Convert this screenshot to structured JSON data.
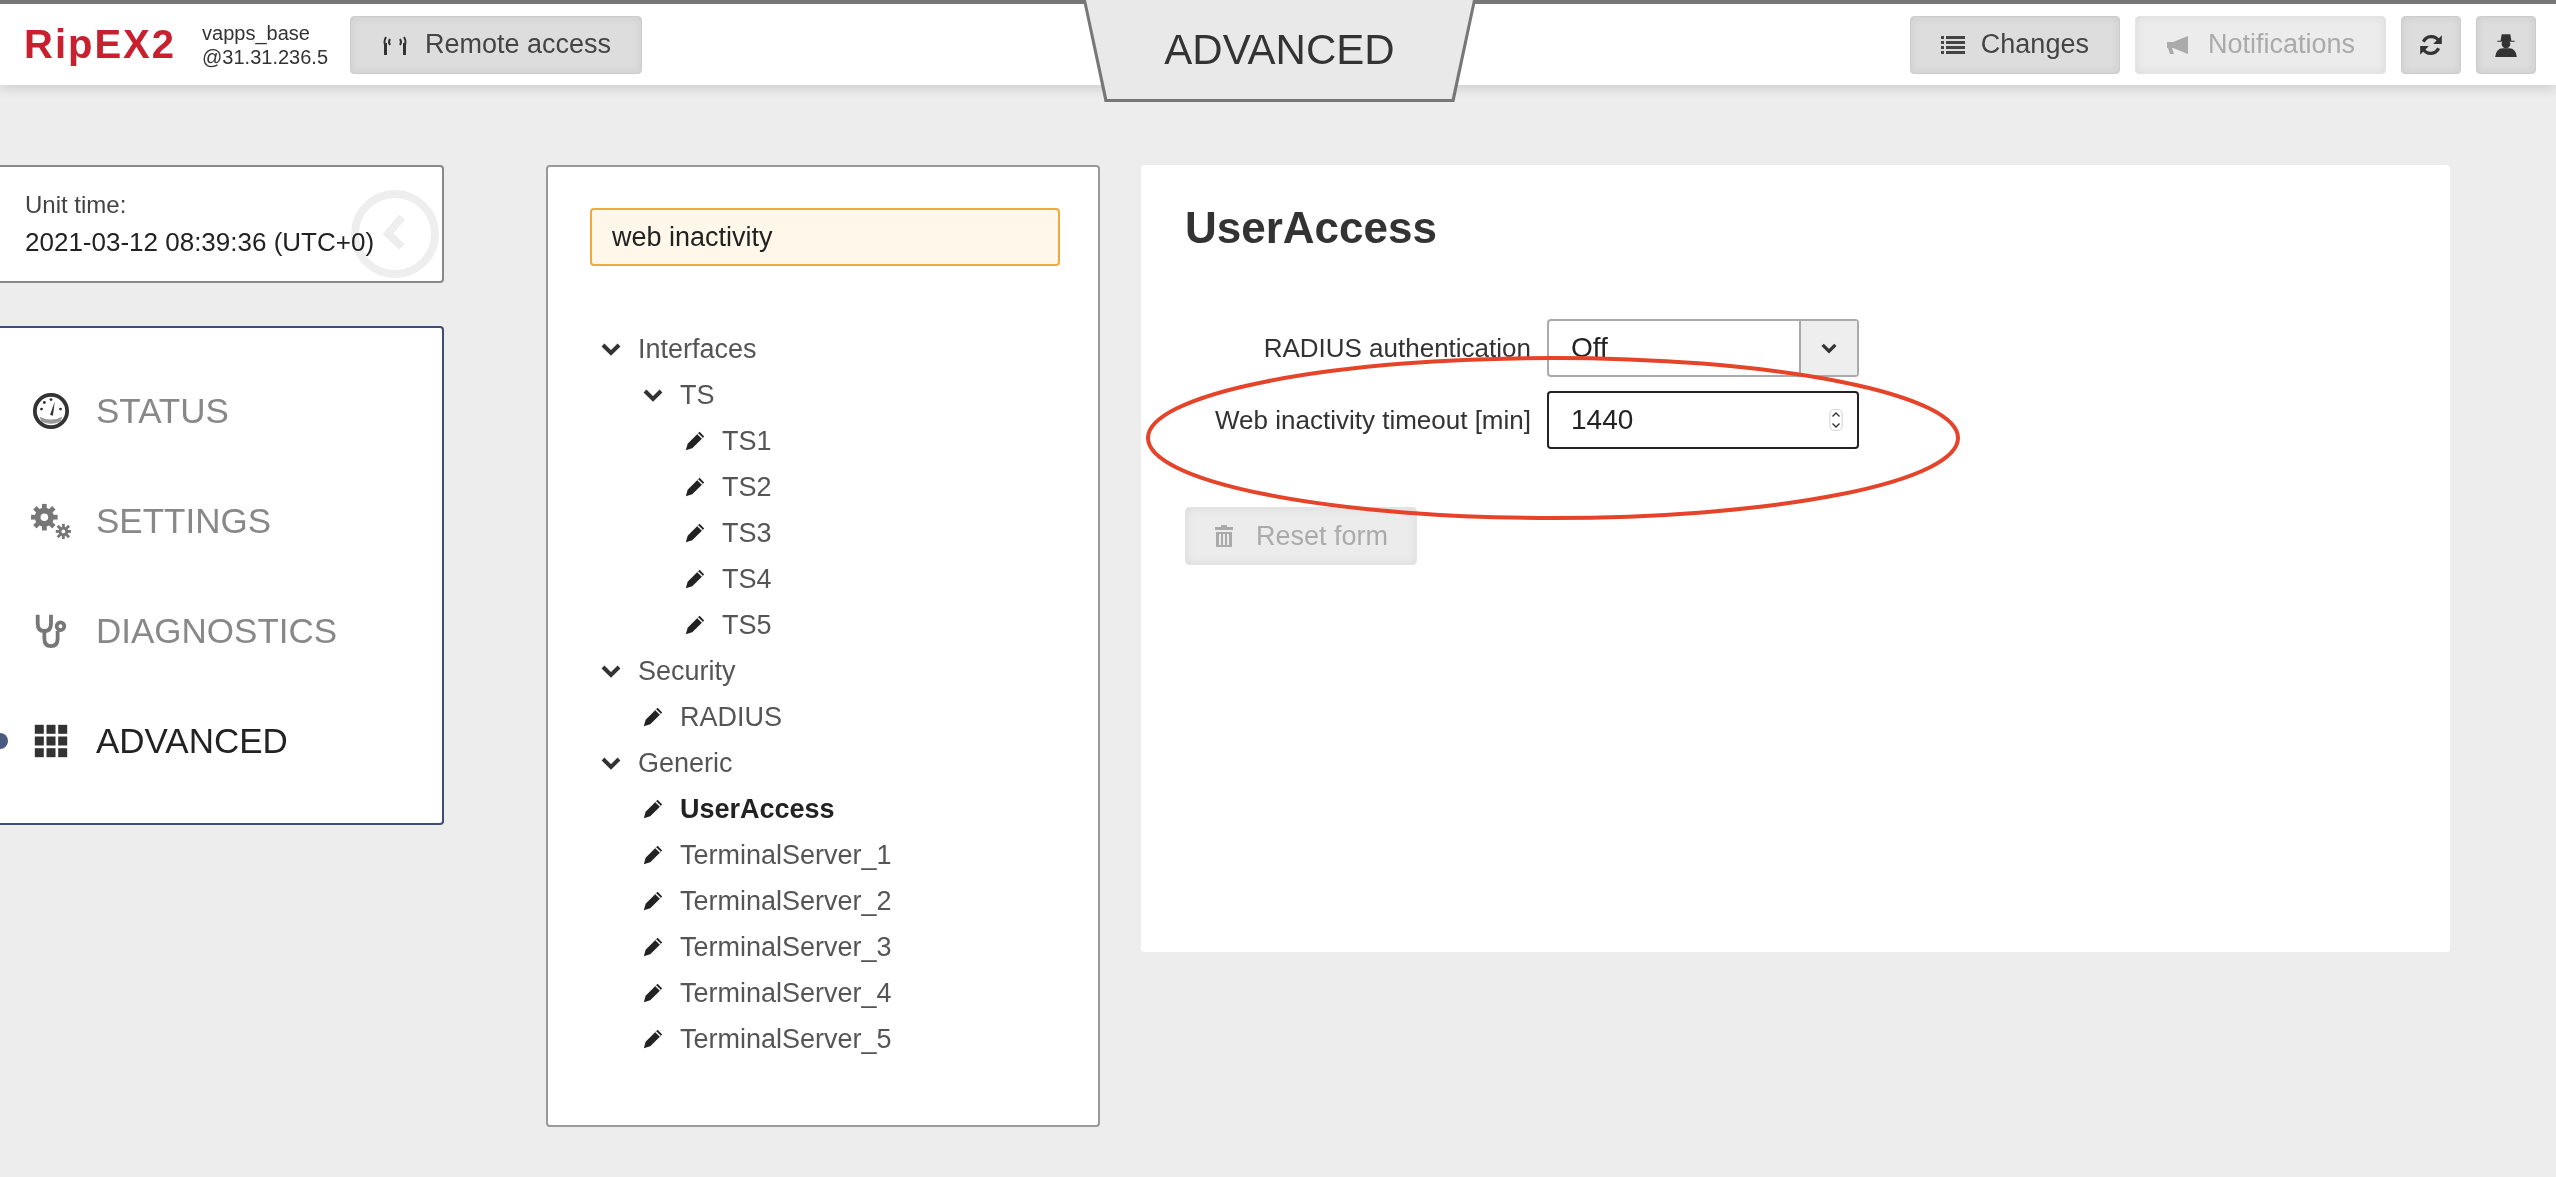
{
  "header": {
    "logo": "RipEX2",
    "unit_name": "vapps_base",
    "unit_address": "@31.31.236.5",
    "remote_button": "Remote access",
    "page_title": "ADVANCED",
    "actions": [
      {
        "kind": "changes",
        "label": "Changes",
        "disabled": false
      },
      {
        "kind": "notifications",
        "label": "Notifications",
        "disabled": true
      },
      {
        "kind": "refresh",
        "disabled": false
      },
      {
        "kind": "user",
        "disabled": false
      }
    ]
  },
  "unit_time": {
    "label": "Unit time:",
    "value": "2021-03-12 08:39:36 (UTC+0)"
  },
  "nav": [
    {
      "label": "STATUS",
      "selected": false
    },
    {
      "label": "SETTINGS",
      "selected": false
    },
    {
      "label": "DIAGNOSTICS",
      "selected": false
    },
    {
      "label": "ADVANCED",
      "selected": true
    }
  ],
  "tree_search": {
    "value": "web inactivity"
  },
  "tree": [
    {
      "label": "Interfaces",
      "kind": "group",
      "expanded": true,
      "children": [
        {
          "label": "TS",
          "kind": "group",
          "expanded": true,
          "children": [
            {
              "label": "TS1",
              "kind": "leaf",
              "selected": false
            },
            {
              "label": "TS2",
              "kind": "leaf",
              "selected": false
            },
            {
              "label": "TS3",
              "kind": "leaf",
              "selected": false
            },
            {
              "label": "TS4",
              "kind": "leaf",
              "selected": false
            },
            {
              "label": "TS5",
              "kind": "leaf",
              "selected": false
            }
          ]
        }
      ]
    },
    {
      "label": "Security",
      "kind": "group",
      "expanded": true,
      "children": [
        {
          "label": "RADIUS",
          "kind": "leaf",
          "selected": false
        }
      ]
    },
    {
      "label": "Generic",
      "kind": "group",
      "expanded": true,
      "children": [
        {
          "label": "UserAccess",
          "kind": "leaf",
          "selected": true
        },
        {
          "label": "TerminalServer_1",
          "kind": "leaf",
          "selected": false
        },
        {
          "label": "TerminalServer_2",
          "kind": "leaf",
          "selected": false
        },
        {
          "label": "TerminalServer_3",
          "kind": "leaf",
          "selected": false
        },
        {
          "label": "TerminalServer_4",
          "kind": "leaf",
          "selected": false
        },
        {
          "label": "TerminalServer_5",
          "kind": "leaf",
          "selected": false
        }
      ]
    }
  ],
  "form": {
    "title": "UserAccess",
    "fields": [
      {
        "label": "RADIUS authentication",
        "kind": "select",
        "value": "Off",
        "focused": false
      },
      {
        "label": "Web inactivity timeout [min]",
        "kind": "number",
        "value": "1440",
        "focused": true
      }
    ],
    "reset_button": {
      "label": "Reset form",
      "disabled": true
    }
  }
}
